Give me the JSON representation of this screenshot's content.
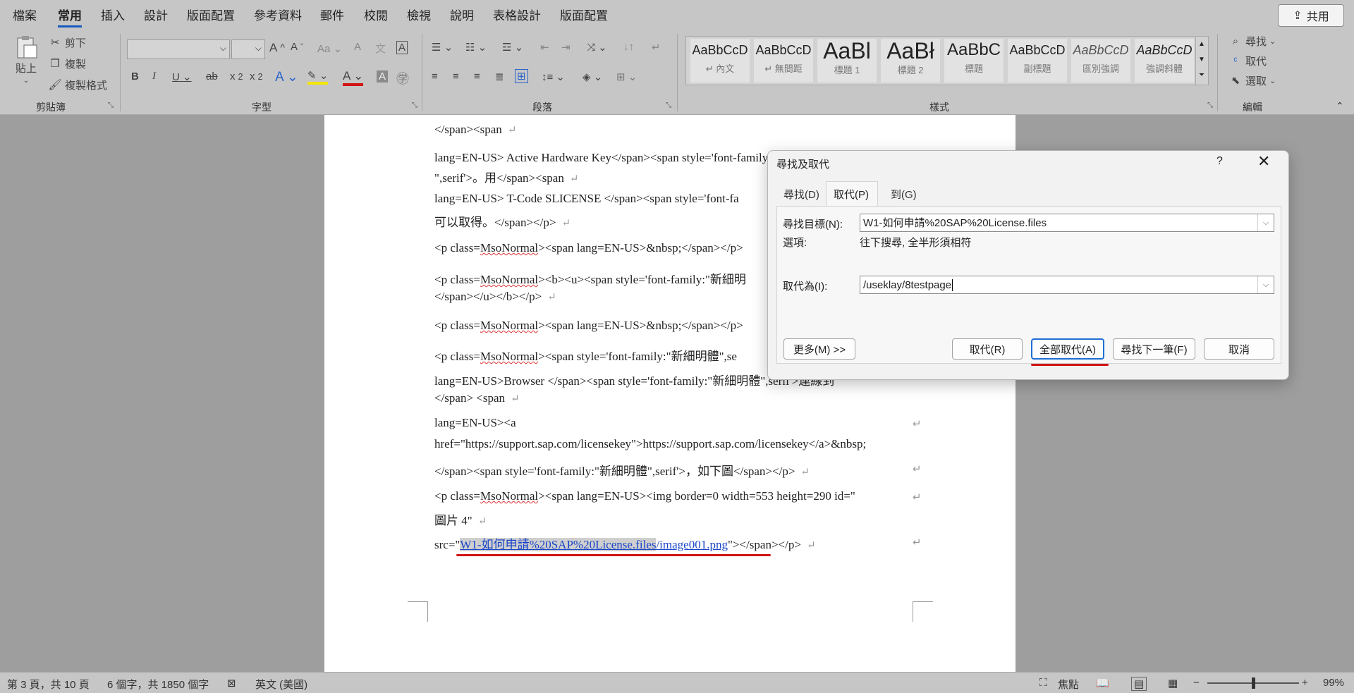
{
  "ribbon_tabs": [
    "檔案",
    "常用",
    "插入",
    "設計",
    "版面配置",
    "參考資料",
    "郵件",
    "校閱",
    "檢視",
    "說明",
    "表格設計",
    "版面配置"
  ],
  "active_tab": "常用",
  "share_label": "共用",
  "clipboard": {
    "paste": "貼上",
    "cut": "剪下",
    "copy": "複製",
    "format_painter": "複製格式",
    "label": "剪貼簿"
  },
  "font_group": {
    "label": "字型",
    "font_name": "",
    "font_size": ""
  },
  "paragraph_group": {
    "label": "段落"
  },
  "styles_group": {
    "label": "樣式",
    "items": [
      {
        "preview": "AaBbCcD",
        "name": "↵ 內文"
      },
      {
        "preview": "AaBbCcD",
        "name": "↵ 無間距"
      },
      {
        "preview": "AaBl",
        "name": "標題 1"
      },
      {
        "preview": "AaBł",
        "name": "標題 2"
      },
      {
        "preview": "AaBbC",
        "name": "標題"
      },
      {
        "preview": "AaBbCcD",
        "name": "副標題"
      },
      {
        "preview": "AaBbCcD",
        "name": "區別強調"
      },
      {
        "preview": "AaBbCcD",
        "name": "強調斜體"
      }
    ]
  },
  "editing_group": {
    "label": "編輯",
    "find": "尋找",
    "replace": "取代",
    "select": "選取"
  },
  "document": {
    "lines": [
      "</span><span",
      "lang=EN-US> Active Hardware Key</span><span style='font-family:\"新細明體",
      "\",serif'>。用</span><span",
      "lang=EN-US> T-Code SLICENSE </span><span style='font-fa",
      "可以取得。</span></p>",
      "<p class=MsoNormal><span lang=EN-US>&nbsp;</span></p>",
      "<p class=MsoNormal><b><u><span style='font-family:\"新細明",
      "</span></u></b></p>",
      "<p class=MsoNormal><span lang=EN-US>&nbsp;</span></p>",
      "<p class=MsoNormal><span style='font-family:\"新細明體\",se",
      "lang=EN-US>Browser </span><span style='font-family:\"新細明體\",serif'>連線到",
      "</span> <span",
      "lang=EN-US><a",
      "href=\"https://support.sap.com/licensekey\">https://support.sap.com/licensekey</a>&nbsp;",
      "</span><span style='font-family:\"新細明體\",serif'>，如下圖</span></p>",
      "<p class=MsoNormal><span lang=EN-US><img border=0 width=553 height=290 id=\"",
      "圖片 4\"",
      "src=\"W1-如何申請%20SAP%20License.files/image001.png\"></span></p>"
    ]
  },
  "dialog": {
    "title": "尋找及取代",
    "help": "?",
    "close": "✕",
    "tabs": [
      "尋找(D)",
      "取代(P)",
      "到(G)"
    ],
    "active_tab": "取代(P)",
    "find_label": "尋找目標(N):",
    "find_value": "W1-如何申請%20SAP%20License.files",
    "options_label": "選項:",
    "options_value": "往下搜尋, 全半形須相符",
    "replace_label": "取代為(I):",
    "replace_value": "/useklay/8testpage",
    "buttons": {
      "more": "更多(M) >>",
      "replace": "取代(R)",
      "replace_all": "全部取代(A)",
      "find_next": "尋找下一筆(F)",
      "cancel": "取消"
    }
  },
  "status_bar": {
    "page": "第 3 頁，共 10 頁",
    "words": "6 個字，共 1850 個字",
    "language": "英文 (美國)",
    "focus": "焦點",
    "zoom": "99%",
    "zoom_level": 0.5
  },
  "colors": {
    "accent": "#185abd",
    "highlight_red": "#d21414"
  }
}
